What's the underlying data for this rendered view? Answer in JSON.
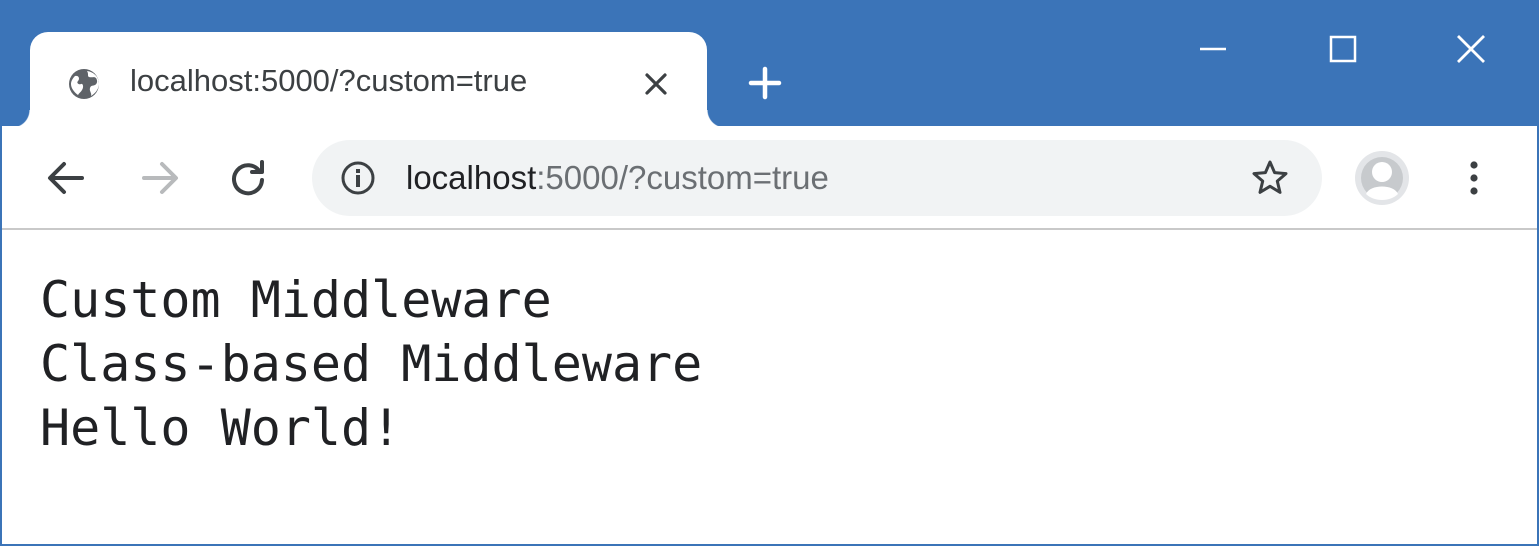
{
  "browser": {
    "tab": {
      "title": "localhost:5000/?custom=true",
      "favicon": "globe-icon"
    },
    "new_tab_icon": "plus-icon",
    "window_controls": [
      "minimize-icon",
      "maximize-icon",
      "close-icon"
    ],
    "address_bar": {
      "host": "localhost",
      "rest": ":5000/?custom=true",
      "info_icon": "info-icon",
      "bookmark_icon": "star-icon"
    },
    "nav_icons": [
      "back-arrow-icon",
      "forward-arrow-icon",
      "reload-icon"
    ],
    "profile_icon": "avatar-icon",
    "menu_icon": "kebab-menu-icon"
  },
  "page": {
    "lines": [
      "Custom Middleware",
      "Class-based Middleware",
      "Hello World!"
    ]
  },
  "colors": {
    "titlebar": "#3b74b8",
    "omnibox": "#f1f3f4",
    "text": "#202124"
  }
}
